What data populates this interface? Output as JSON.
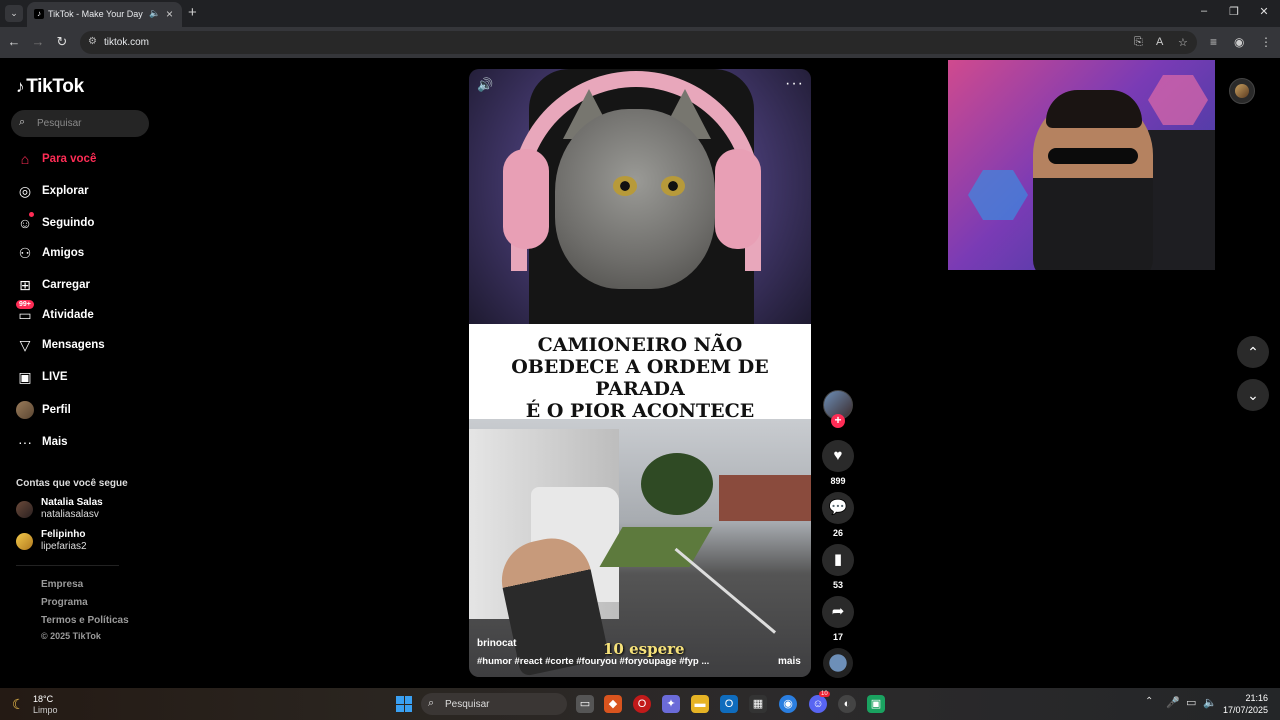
{
  "browser": {
    "tab_title": "TikTok - Make Your Day",
    "url": "tiktok.com"
  },
  "sidebar": {
    "logo": "TikTok",
    "search_placeholder": "Pesquisar",
    "nav": [
      {
        "label": "Para você",
        "icon": "home-icon",
        "active": true
      },
      {
        "label": "Explorar",
        "icon": "compass-icon"
      },
      {
        "label": "Seguindo",
        "icon": "following-icon"
      },
      {
        "label": "Amigos",
        "icon": "friends-icon"
      },
      {
        "label": "Carregar",
        "icon": "upload-icon"
      },
      {
        "label": "Atividade",
        "icon": "activity-icon",
        "badge": "99+"
      },
      {
        "label": "Mensagens",
        "icon": "messages-icon"
      },
      {
        "label": "LIVE",
        "icon": "live-icon"
      },
      {
        "label": "Perfil",
        "icon": "profile-avatar"
      },
      {
        "label": "Mais",
        "icon": "more-icon"
      }
    ],
    "following_title": "Contas que você segue",
    "following": [
      {
        "name": "Natalia Salas",
        "handle": "nataliasalasv"
      },
      {
        "name": "Felipinho",
        "handle": "lipefarias2"
      }
    ],
    "footer": [
      "Empresa",
      "Programa",
      "Termos e Políticas"
    ],
    "copyright": "© 2025 TikTok"
  },
  "video": {
    "headline_lines": [
      "CAMIONEIRO NÃO",
      "OBEDECE A ORDEM DE PARADA",
      "É O PIOR ACONTECE"
    ],
    "subtitle": "10 espere",
    "author": "brinocat",
    "tags": "#humor #react #corte #fouryou #foryoupage #fyp ...",
    "more_label": "mais"
  },
  "actions": {
    "likes": "899",
    "comments": "26",
    "saves": "53",
    "shares": "17"
  },
  "taskbar": {
    "temperature": "18°C",
    "weather": "Limpo",
    "search_placeholder": "Pesquisar",
    "time": "21:16",
    "date": "17/07/2025",
    "discord_badge": "10"
  },
  "colors": {
    "accent": "#fe2c55",
    "background": "#000000",
    "sidebar_search": "#252525"
  }
}
